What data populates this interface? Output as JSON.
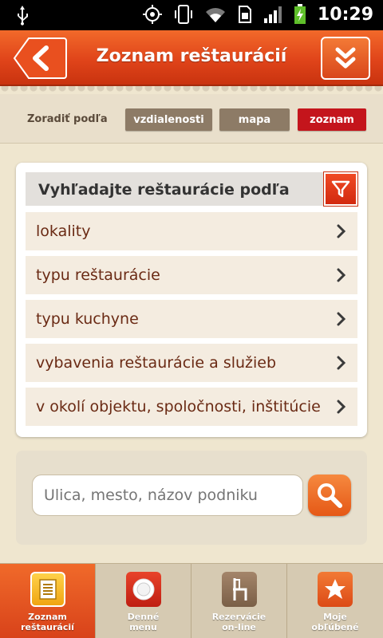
{
  "status_bar": {
    "time": "10:29"
  },
  "header": {
    "title": "Zoznam reštaurácií"
  },
  "sort": {
    "label": "Zoradiť podľa",
    "options": [
      "vzdialenosti",
      "mapa",
      "zoznam"
    ],
    "selected": "zoznam"
  },
  "filter": {
    "title": "Vyhľadajte reštaurácie podľa",
    "items": [
      {
        "label": "lokality"
      },
      {
        "label": "typu reštaurácie"
      },
      {
        "label": "typu kuchyne"
      },
      {
        "label": "vybavenia reštaurácie a služieb"
      },
      {
        "label": "v okolí objektu, spoločnosti, inštitúcie"
      }
    ]
  },
  "search": {
    "placeholder": "Ulica, mesto, názov podniku"
  },
  "bottom_nav": {
    "items": [
      {
        "line1": "Zoznam",
        "line2": "reštaurácií",
        "icon": "list-icon",
        "active": true
      },
      {
        "line1": "Denné",
        "line2": "menu",
        "icon": "plate-icon",
        "active": false
      },
      {
        "line1": "Rezervácie",
        "line2": "on-line",
        "icon": "chair-icon",
        "active": false
      },
      {
        "line1": "Moje",
        "line2": "obľúbené",
        "icon": "star-icon",
        "active": false
      }
    ]
  },
  "colors": {
    "brand_orange": "#e0441a",
    "selected_red": "#c4151c",
    "sort_brown": "#8d7b66",
    "row_text": "#6a2a14"
  }
}
